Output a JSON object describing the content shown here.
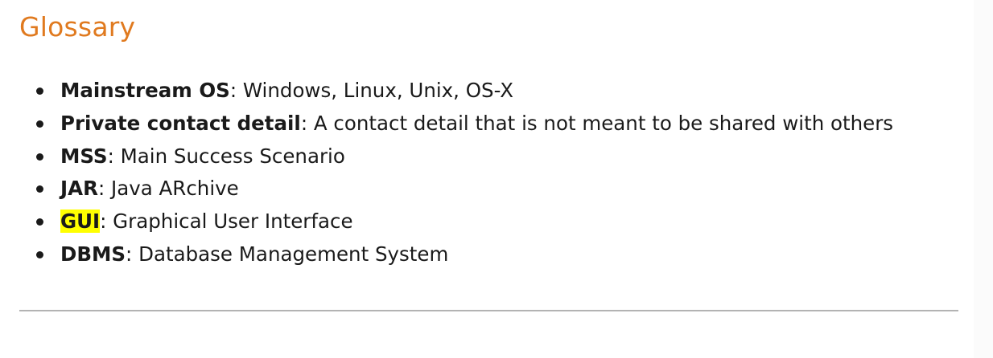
{
  "heading": "Glossary",
  "entries": [
    {
      "term": "Mainstream OS",
      "separator": ":",
      "definition": " Windows, Linux, Unix, OS-X",
      "highlighted": false
    },
    {
      "term": "Private contact detail",
      "separator": ":",
      "definition": " A contact detail that is not meant to be shared with others",
      "highlighted": false
    },
    {
      "term": "MSS",
      "separator": ":",
      "definition": " Main Success Scenario",
      "highlighted": false
    },
    {
      "term": "JAR",
      "separator": ":",
      "definition": " Java ARchive",
      "highlighted": false
    },
    {
      "term": "GUI",
      "separator": ":",
      "definition": " Graphical User Interface",
      "highlighted": true
    },
    {
      "term": "DBMS",
      "separator": ":",
      "definition": " Database Management System",
      "highlighted": false
    }
  ],
  "colors": {
    "heading": "#e07a1f",
    "highlight": "#ffff00",
    "rule": "#b3b3b3"
  }
}
